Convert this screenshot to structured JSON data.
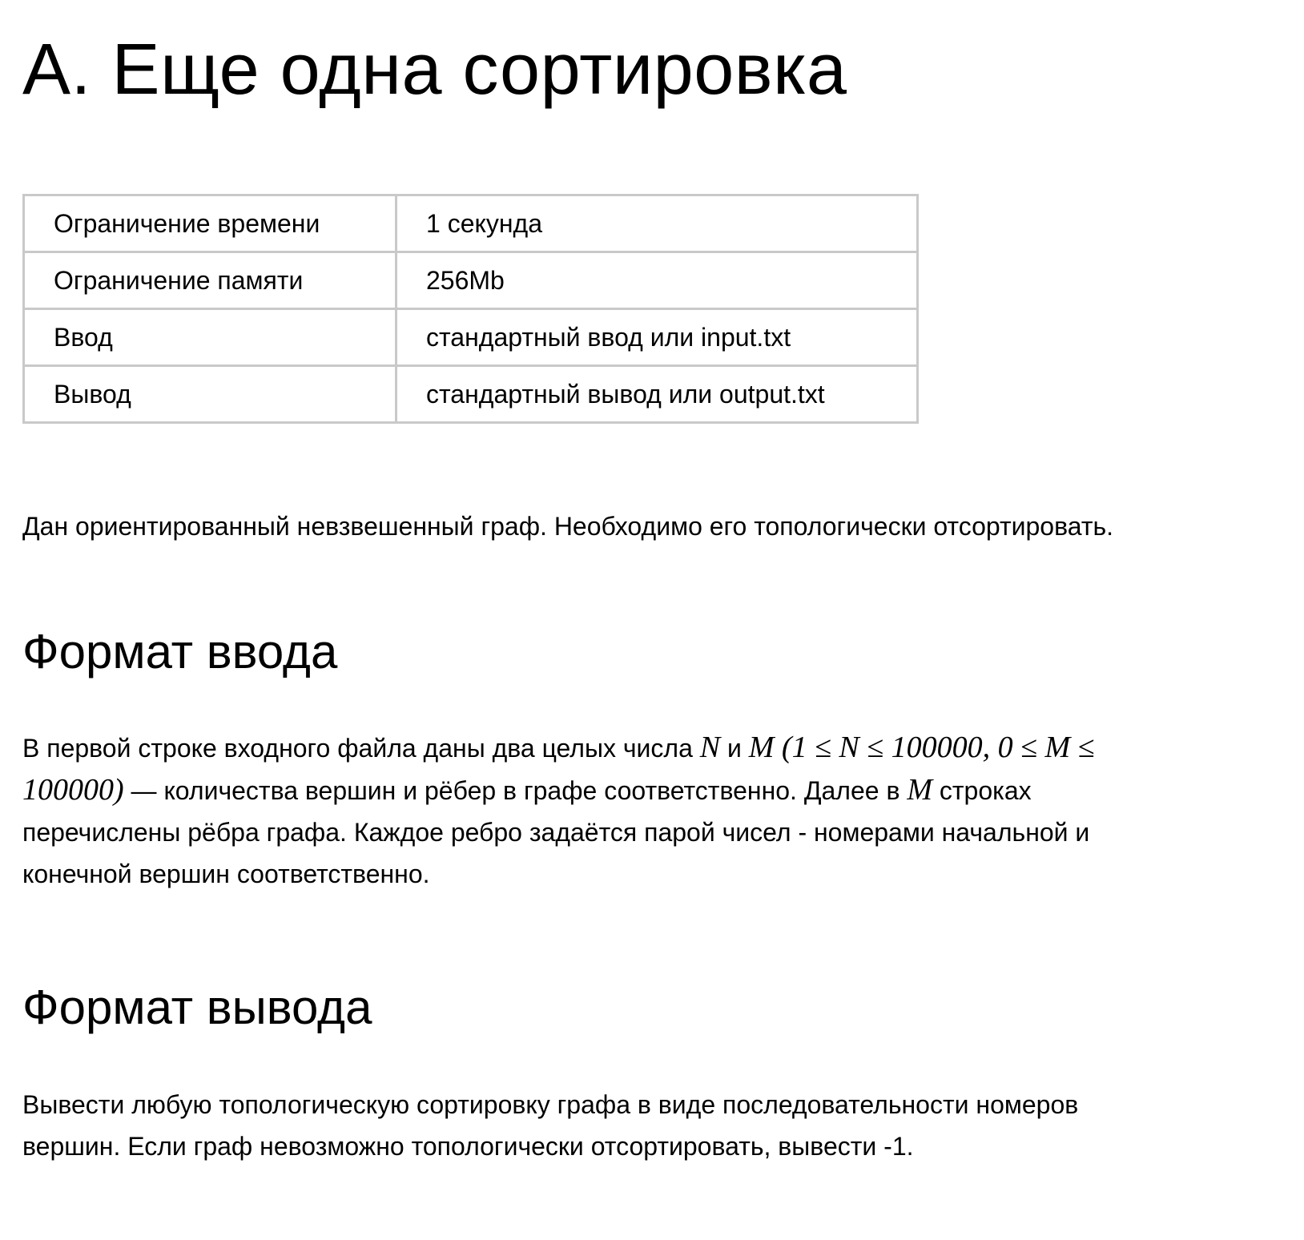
{
  "problem": {
    "title": "A. Еще одна сортировка"
  },
  "limits": [
    {
      "label": "Ограничение времени",
      "value": "1 секунда"
    },
    {
      "label": "Ограничение памяти",
      "value": "256Mb"
    },
    {
      "label": "Ввод",
      "value": "стандартный ввод или input.txt"
    },
    {
      "label": "Вывод",
      "value": "стандартный вывод или output.txt"
    }
  ],
  "statement": {
    "intro": "Дан ориентированный невзвешенный граф. Необходимо его топологически отсортировать."
  },
  "input_section": {
    "heading": "Формат ввода",
    "line1_text": "В первой строке входного файла даны два целых числа ",
    "line1_math_n": "N",
    "line1_and": " и ",
    "line1_math_m": "M (1 ≤ N ≤ 100000, 0 ≤ M ≤",
    "line2_math": "100000)",
    "line2_text": " — количества вершин и рёбер в графе соответственно. Далее в ",
    "line2_math_m": "M",
    "line2_text_end": " строках",
    "line3_text": "перечислены рёбра графа. Каждое ребро задаётся парой чисел - номерами начальной и",
    "line4_text": "конечной вершин соответственно."
  },
  "output_section": {
    "heading": "Формат вывода",
    "line1_text": "Вывести любую топологическую сортировку графа в виде последовательности номеров",
    "line2_text": "вершин. Если граф невозможно топологически отсортировать, вывести -1."
  }
}
